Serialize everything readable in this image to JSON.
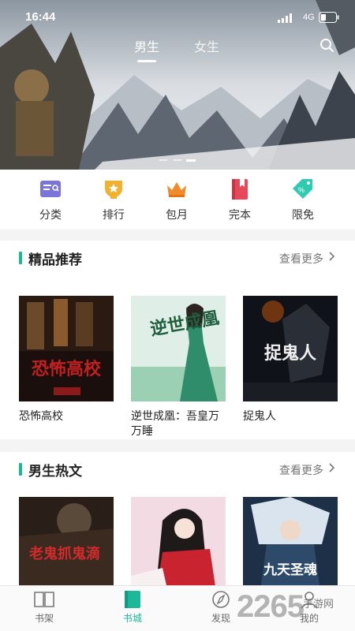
{
  "status": {
    "time": "16:44",
    "network": "4G"
  },
  "top_tabs": [
    {
      "label": "男生",
      "active": true
    },
    {
      "label": "女生",
      "active": false
    }
  ],
  "quick_nav": [
    {
      "label": "分类",
      "icon": "category-icon",
      "color": "#7b74d9"
    },
    {
      "label": "排行",
      "icon": "ranking-icon",
      "color": "#f2b02c"
    },
    {
      "label": "包月",
      "icon": "crown-icon",
      "color": "#f08a2a"
    },
    {
      "label": "完本",
      "icon": "book-icon",
      "color": "#e64a5a"
    },
    {
      "label": "限免",
      "icon": "free-tag-icon",
      "color": "#2ecbb1"
    }
  ],
  "sections": [
    {
      "title": "精品推荐",
      "more": "查看更多",
      "books": [
        {
          "title": "恐怖高校",
          "cover_text": "恐怖高校"
        },
        {
          "title": "逆世成凰：吾皇万万睡",
          "cover_text": "逆世成凰"
        },
        {
          "title": "捉鬼人",
          "cover_text": "捉鬼人"
        }
      ]
    },
    {
      "title": "男生热文",
      "more": "查看更多",
      "books": [
        {
          "cover_text": "老鬼抓鬼滴"
        },
        {
          "cover_text": ""
        },
        {
          "cover_text": "九天圣魂"
        }
      ]
    }
  ],
  "bottom_nav": [
    {
      "label": "书架",
      "icon": "bookshelf-icon",
      "active": false
    },
    {
      "label": "书城",
      "icon": "bookstore-icon",
      "active": true
    },
    {
      "label": "发现",
      "icon": "compass-icon",
      "active": false
    },
    {
      "label": "我的",
      "icon": "profile-icon",
      "active": false
    }
  ],
  "watermark": {
    "number": "2265",
    "text": "手游网"
  },
  "colors": {
    "accent": "#1bb99a"
  }
}
